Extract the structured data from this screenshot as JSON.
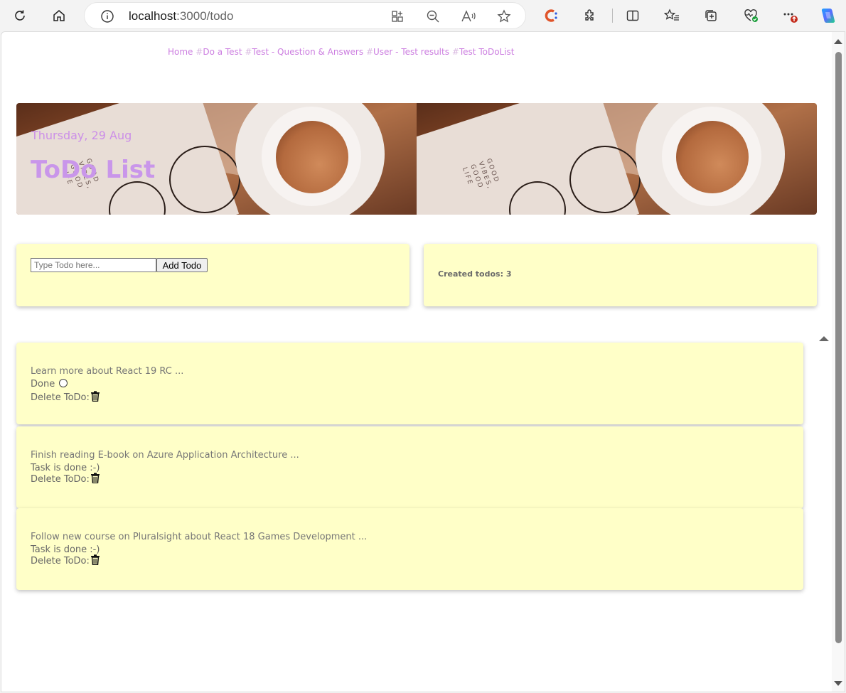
{
  "browser": {
    "url_host": "localhost",
    "url_rest": ":3000/todo"
  },
  "nav": {
    "items": [
      {
        "prefix": "",
        "label": "Home"
      },
      {
        "prefix": "#",
        "label": "Do a Test"
      },
      {
        "prefix": "#",
        "label": "Test - Question & Answers"
      },
      {
        "prefix": "#",
        "label": "User - Test results"
      },
      {
        "prefix": "#",
        "label": "Test ToDoList"
      }
    ]
  },
  "banner": {
    "date": "Thursday, 29 Aug",
    "title": "ToDo List",
    "image_text": "GOOD VIBES, GOOD LIFE"
  },
  "add_form": {
    "placeholder": "Type Todo here...",
    "button_label": "Add Todo"
  },
  "stats": {
    "created_label": "Created todos: 3"
  },
  "todos": [
    {
      "text": "Learn more about React 19 RC ...",
      "status": "Done",
      "delete_label": "Delete ToDo:"
    },
    {
      "text": "Finish reading E-book on Azure Application Architecture ...",
      "status": "Task is done :-)",
      "delete_label": "Delete ToDo:"
    },
    {
      "text": "Follow new course on Pluralsight about React 18 Games Development ...",
      "status": "Task is done :-)",
      "delete_label": "Delete ToDo:"
    }
  ],
  "colors": {
    "card_bg": "#ffffc8",
    "nav_link": "#cc7ee0",
    "title": "#c996ea"
  }
}
